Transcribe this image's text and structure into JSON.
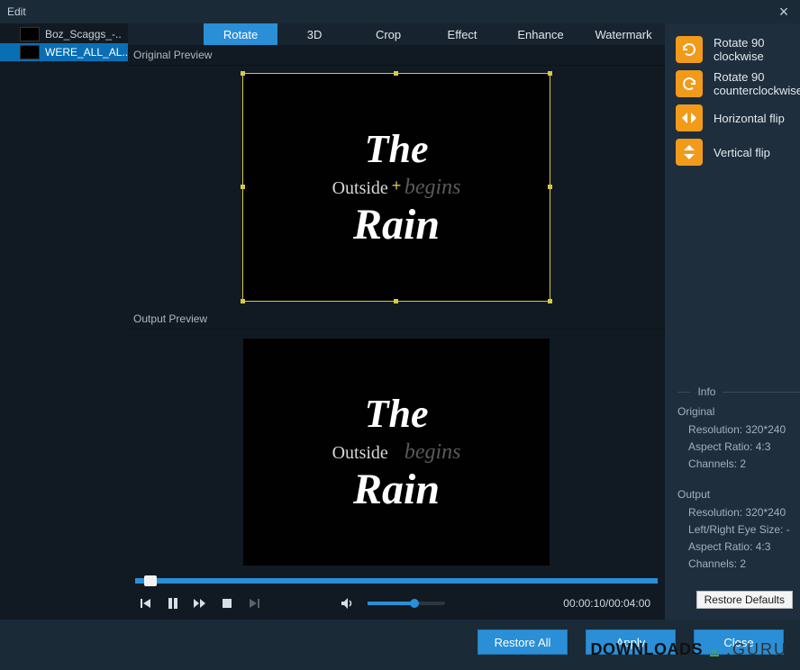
{
  "window": {
    "title": "Edit",
    "close_icon": "×"
  },
  "sidebar": {
    "items": [
      {
        "name": "Boz_Scaggs_-..",
        "selected": false
      },
      {
        "name": "WERE_ALL_AL..",
        "selected": true
      }
    ]
  },
  "tabs": [
    "Rotate",
    "3D",
    "Crop",
    "Effect",
    "Enhance",
    "Watermark"
  ],
  "active_tab_index": 0,
  "previews": {
    "original_label": "Original Preview",
    "output_label": "Output Preview"
  },
  "controls": {
    "time": "00:00:10/00:04:00"
  },
  "actions": [
    {
      "label": "Rotate 90 clockwise",
      "icon": "rotate-cw"
    },
    {
      "label": "Rotate 90 counterclockwise",
      "icon": "rotate-ccw"
    },
    {
      "label": "Horizontal flip",
      "icon": "flip-h"
    },
    {
      "label": "Vertical flip",
      "icon": "flip-v"
    }
  ],
  "info": {
    "title": "Info",
    "original": {
      "title": "Original",
      "resolution": "Resolution: 320*240",
      "aspect": "Aspect Ratio: 4:3",
      "channels": "Channels: 2"
    },
    "output": {
      "title": "Output",
      "resolution": "Resolution: 320*240",
      "eye": "Left/Right Eye Size: -",
      "aspect": "Aspect Ratio: 4:3",
      "channels": "Channels: 2"
    }
  },
  "restore_defaults": "Restore Defaults",
  "footer": {
    "restore_all": "Restore All",
    "apply": "Apply",
    "close": "Close"
  },
  "watermark": {
    "downloads": "DOWNLOADS",
    "guru": ".GURU"
  }
}
